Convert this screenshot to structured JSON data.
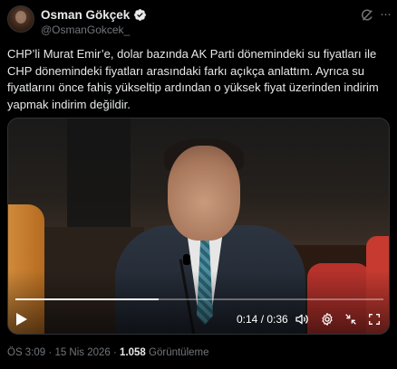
{
  "author": {
    "display_name": "Osman Gökçek",
    "handle": "@OsmanGokcek_",
    "verified": true,
    "avatar_icon": "profile-photo"
  },
  "header_icons": {
    "grok": "grok-icon",
    "more": "more-icon"
  },
  "tweet": {
    "text": "CHP’li Murat Emir’e, dolar bazında AK Parti dönemindeki su fiyatları ile CHP dönemindeki fiyatları arasındaki farkı açıkça anlattım. Ayrıca su fiyatlarını önce fahiş yükseltip ardından o yüksek fiyat üzerinden indirim yapmak indirim değildir."
  },
  "video": {
    "time_display": "0:14 / 0:36",
    "progress_fraction": 0.39,
    "controls": [
      "play-icon",
      "volume-icon",
      "settings-gear-icon",
      "collapse-icon",
      "fullscreen-icon"
    ]
  },
  "meta": {
    "time": "ÖS 3:09",
    "separator1": " · ",
    "date": "15 Nis 2026",
    "separator2": " · ",
    "views_count": "1.058",
    "views_label": " Görüntüleme"
  },
  "colors": {
    "background": "#000000",
    "text_primary": "#e7e9ea",
    "text_secondary": "#71767b",
    "verified_blue": "#1d9bf0"
  }
}
